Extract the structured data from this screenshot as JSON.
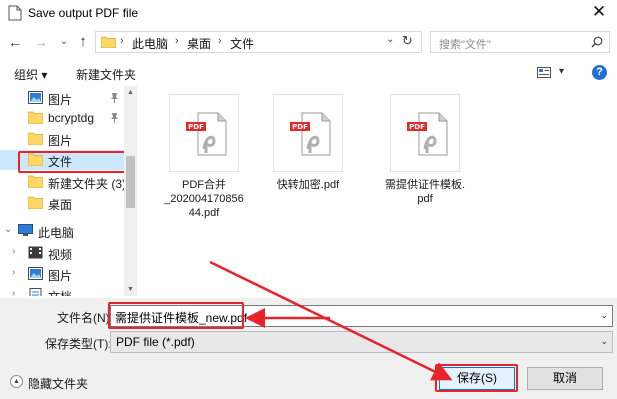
{
  "window": {
    "title": "Save output PDF file",
    "close_glyph": "✕",
    "icon": "document-icon"
  },
  "nav": {
    "back": "←",
    "forward": "→",
    "recent": "⌄",
    "up": "↑"
  },
  "address": {
    "crumbs": [
      "此电脑",
      "桌面",
      "文件"
    ],
    "separator": "›",
    "dropdown": "⌄",
    "refresh": "↻"
  },
  "search": {
    "placeholder": "搜索\"文件\""
  },
  "toolbar": {
    "organize": "组织 ▾",
    "new_folder": "新建文件夹",
    "view_arrow": "▾",
    "help": "?"
  },
  "sidebar": {
    "items": [
      {
        "label": "图片",
        "icon": "pictures-icon",
        "pinned": true
      },
      {
        "label": "bcryptdg",
        "icon": "folder-icon",
        "pinned": true
      },
      {
        "label": "图片",
        "icon": "folder-icon"
      },
      {
        "label": "文件",
        "icon": "folder-icon",
        "selected": true
      },
      {
        "label": "新建文件夹 (3)",
        "icon": "folder-icon"
      },
      {
        "label": "桌面",
        "icon": "folder-icon"
      },
      {
        "label": "此电脑",
        "icon": "computer-icon",
        "expanded": true
      },
      {
        "label": "视频",
        "icon": "video-icon"
      },
      {
        "label": "图片",
        "icon": "pictures-icon"
      },
      {
        "label": "文档",
        "icon": "documents-icon"
      }
    ],
    "pin_glyph": "📌",
    "expand_collapsed": "›",
    "expand_open": "⌄"
  },
  "files": [
    {
      "name_lines": [
        "PDF合并",
        "_202004170856",
        "44.pdf"
      ],
      "type": "pdf"
    },
    {
      "name_lines": [
        "快转加密.pdf"
      ],
      "type": "pdf"
    },
    {
      "name_lines": [
        "需提供证件模板.",
        "pdf"
      ],
      "type": "pdf"
    }
  ],
  "pdf_badge": "PDF",
  "form": {
    "filename_label": "文件名(N):",
    "filename_value": "需提供证件模板_new.pdf",
    "filetype_label": "保存类型(T):",
    "filetype_value": "PDF file (*.pdf)",
    "hide_folders": "隐藏文件夹",
    "hide_glyph": "▲",
    "save": "保存(S)",
    "cancel": "取消"
  },
  "colors": {
    "highlight_red": "#e8232a",
    "selection_blue": "#cce8ff",
    "accent_blue": "#0078d7",
    "folder_yellow": "#ffd767",
    "pdf_red": "#e02b2b"
  }
}
